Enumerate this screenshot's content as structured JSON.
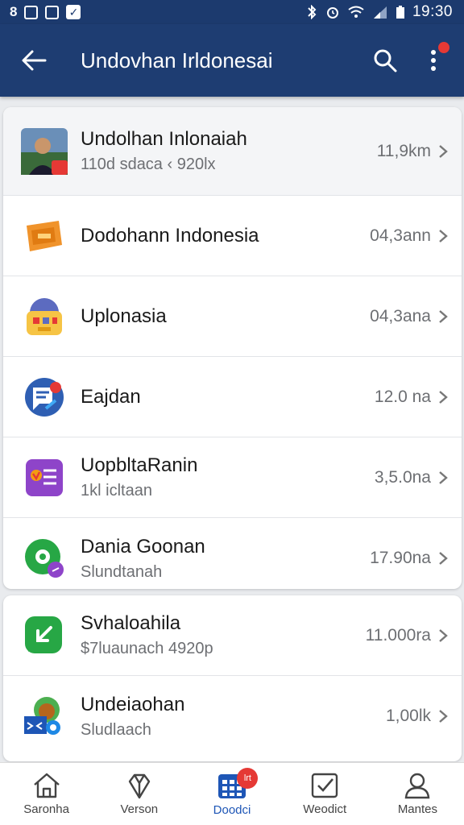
{
  "statusbar": {
    "left_glyph": "8",
    "time": "19:30"
  },
  "appbar": {
    "title": "Undovhan Irldonesai"
  },
  "list_card_1": [
    {
      "title": "Undolhan Inlonaiah",
      "subtitle": "110d sdaca ‹ 920lx",
      "value": "11,9km",
      "icon": "profile-photo-icon"
    },
    {
      "title": "Dodohann Indonesia",
      "subtitle": "",
      "value": "04,3ann",
      "icon": "ticket-icon"
    },
    {
      "title": "Uplonasia",
      "subtitle": "",
      "value": "04,3ana",
      "icon": "shop-icon"
    },
    {
      "title": "Eajdan",
      "subtitle": "",
      "value": "12.0 na",
      "icon": "chat-bubble-icon"
    },
    {
      "title": "UopbltaRanin",
      "subtitle": "1kl icltaan",
      "value": "3,5.0na",
      "icon": "document-icon"
    },
    {
      "title": "Dania Goonan",
      "subtitle": "Slundtanah",
      "value": "17.90na",
      "icon": "location-icon"
    }
  ],
  "list_card_2": [
    {
      "title": "Svhaloahila",
      "subtitle": "$7luaunach 4920p",
      "value": "11.000ra",
      "icon": "arrow-badge-icon"
    },
    {
      "title": "Undeiaohan",
      "subtitle": "Sludlaach",
      "value": "1,00lk",
      "icon": "map-avatar-icon"
    }
  ],
  "bottom_nav": [
    {
      "label": "Saronha",
      "icon": "home-icon"
    },
    {
      "label": "Verson",
      "icon": "pen-icon"
    },
    {
      "label": "Doodci",
      "icon": "calendar-icon",
      "active": true,
      "badge": "lrt"
    },
    {
      "label": "Weodict",
      "icon": "checkbox-icon"
    },
    {
      "label": "Mantes",
      "icon": "person-icon"
    }
  ],
  "colors": {
    "primary": "#1e3d72",
    "accent": "#1e56b6",
    "badge": "#e53935"
  }
}
